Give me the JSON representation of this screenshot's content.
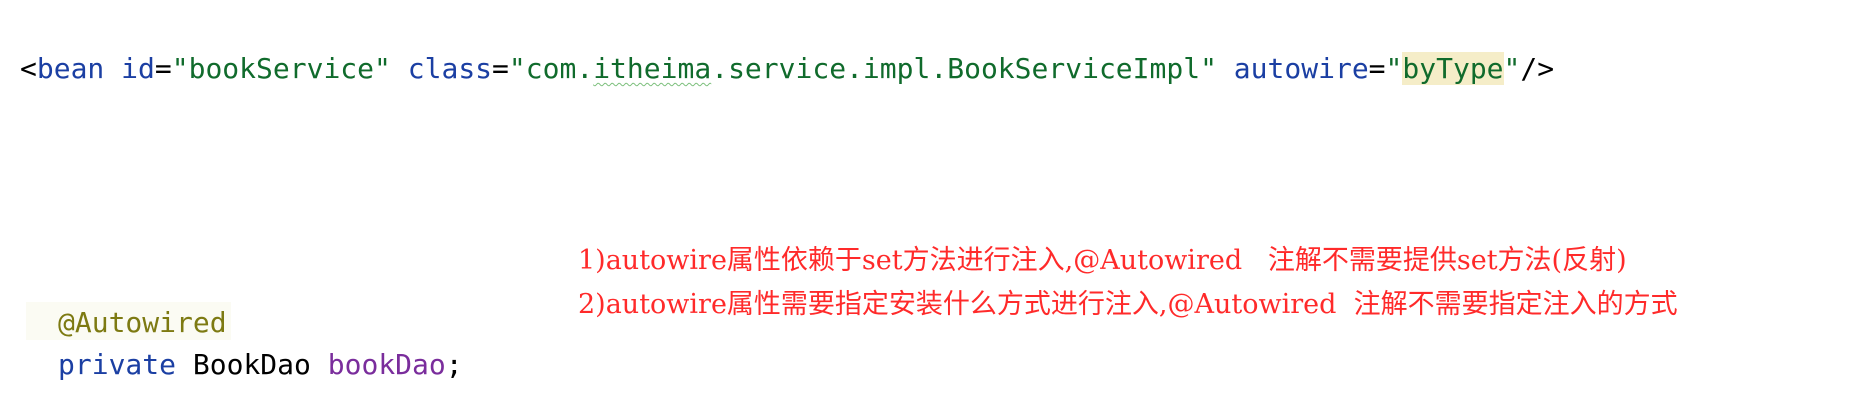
{
  "xml_line": {
    "open": "<",
    "tag": "bean",
    "id_attr": " id",
    "eq1": "=",
    "id_value": "\"bookService\"",
    "class_attr": " class",
    "eq2": "=",
    "class_q": "\"",
    "class_pkg_a": "com.",
    "class_pkg_b": "itheima",
    "class_pkg_c": ".service.impl.BookServiceImpl\"",
    "autowire_attr": " autowire",
    "eq3": "=",
    "q_open": "\"",
    "autowire_value": "byType",
    "q_close": "\"",
    "close": "/>"
  },
  "notes": {
    "line1": "1)autowire属性依赖于set方法进行注入,@Autowired   注解不需要提供set方法(反射)",
    "line2": "2)autowire属性需要指定安装什么方式进行注入,@Autowired  注解不需要指定注入的方式"
  },
  "java_code": {
    "annotation": "@Autowired",
    "modifier": "private",
    "type": "BookDao",
    "field": "bookDao",
    "semicolon": ";"
  }
}
